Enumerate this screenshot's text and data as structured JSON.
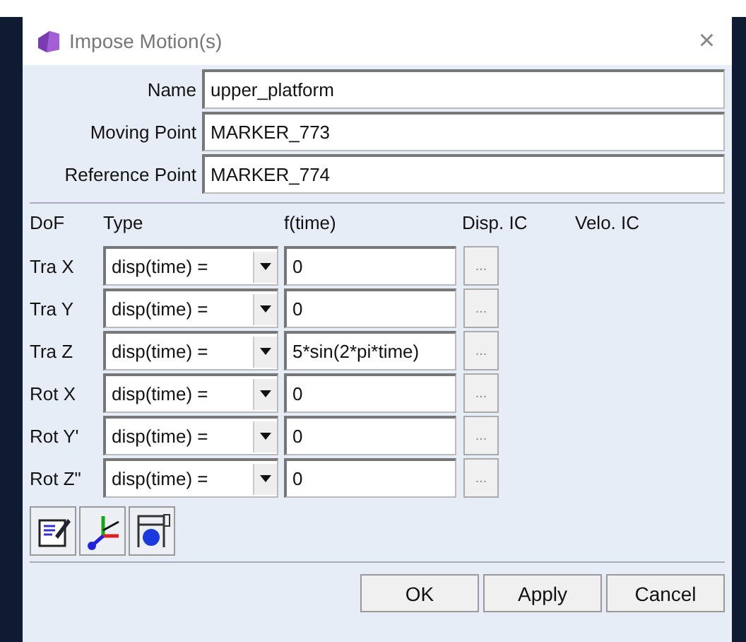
{
  "window": {
    "title": "Impose Motion(s)",
    "close": "×"
  },
  "fields": [
    {
      "label": "Name",
      "value": "upper_platform"
    },
    {
      "label": "Moving Point",
      "value": "MARKER_773"
    },
    {
      "label": "Reference Point",
      "value": "MARKER_774"
    }
  ],
  "columns": [
    "DoF",
    "Type",
    "f(time)",
    "Disp. IC",
    "Velo. IC"
  ],
  "rows": [
    {
      "dof": "Tra X",
      "type": "disp(time) =",
      "f": "0",
      "more": "..."
    },
    {
      "dof": "Tra Y",
      "type": "disp(time) =",
      "f": "0",
      "more": "..."
    },
    {
      "dof": "Tra Z",
      "type": "disp(time) =",
      "f": "5*sin(2*pi*time)",
      "more": "..."
    },
    {
      "dof": "Rot X",
      "type": "disp(time) =",
      "f": "0",
      "more": "..."
    },
    {
      "dof": "Rot Y'",
      "type": "disp(time) =",
      "f": "0",
      "more": "..."
    },
    {
      "dof": "Rot Z\"",
      "type": "disp(time) =",
      "f": "0",
      "more": "..."
    }
  ],
  "tools": [
    {
      "kind": "edit"
    },
    {
      "kind": "axes"
    },
    {
      "kind": "caliper"
    }
  ],
  "buttons": [
    "OK",
    "Apply",
    "Cancel"
  ]
}
